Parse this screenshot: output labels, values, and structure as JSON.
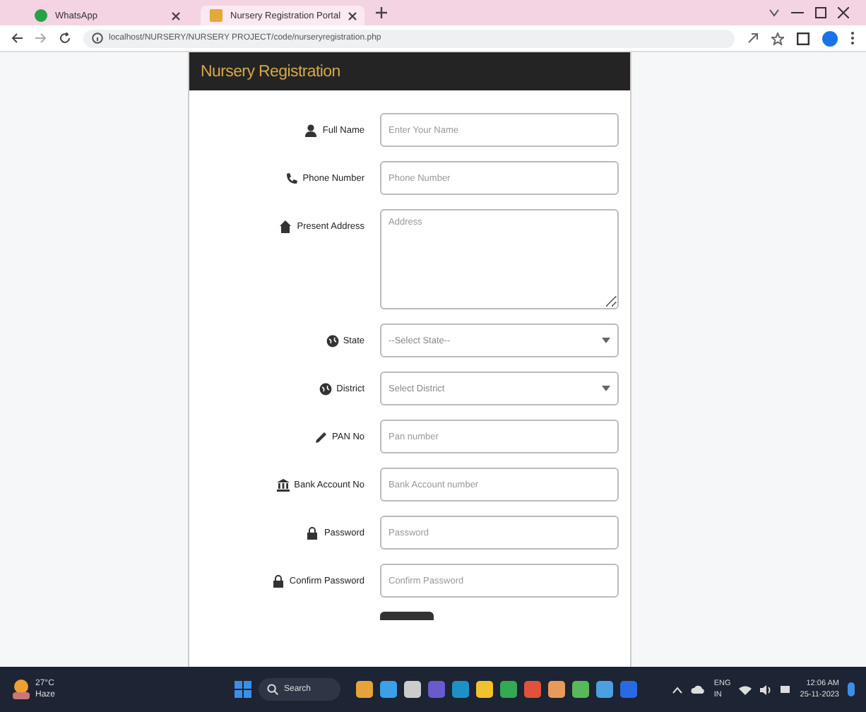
{
  "browser": {
    "tabs": [
      {
        "title": "WhatsApp",
        "selected": false
      },
      {
        "title": "Nursery Registration Portal",
        "selected": true
      }
    ],
    "url": "localhost/NURSERY/NURSERY PROJECT/code/nurseryregistration.php"
  },
  "page": {
    "title": "Nursery Registration",
    "fields": [
      {
        "kind": "input",
        "label": "Full Name",
        "placeholder": "Enter Your Name"
      },
      {
        "kind": "input",
        "label": "Phone Number",
        "placeholder": "Phone Number"
      },
      {
        "kind": "textarea",
        "label": "Present Address",
        "placeholder": "Address"
      },
      {
        "kind": "select",
        "label": "State",
        "placeholder": "--Select State--"
      },
      {
        "kind": "select",
        "label": "District",
        "placeholder": "Select District"
      },
      {
        "kind": "input",
        "label": "PAN No",
        "placeholder": "Pan number"
      },
      {
        "kind": "input",
        "label": "Bank Account No",
        "placeholder": "Bank Account number"
      },
      {
        "kind": "input",
        "label": "Password",
        "placeholder": "Password"
      },
      {
        "kind": "input",
        "label": "Confirm Password",
        "placeholder": "Confirm Password"
      }
    ]
  },
  "taskbar": {
    "weather": [
      "27°C",
      "Haze"
    ],
    "search": "Search",
    "language": [
      "ENG",
      "IN"
    ],
    "time": "12:06 AM",
    "date": "25-11-2023"
  }
}
